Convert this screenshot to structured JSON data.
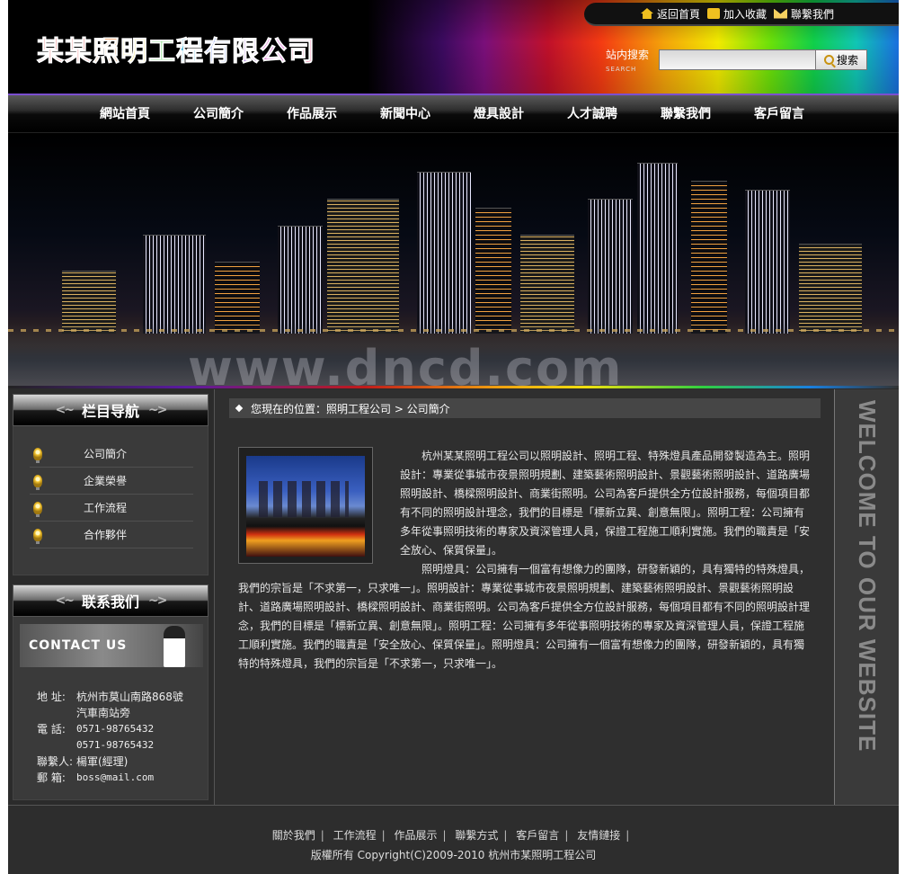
{
  "header": {
    "logo_chars": [
      {
        "ch": "某",
        "color": "#e01818"
      },
      {
        "ch": "某",
        "color": "#e01818"
      },
      {
        "ch": "照",
        "color": "#f07010"
      },
      {
        "ch": "明",
        "color": "#f0d010"
      },
      {
        "ch": "工",
        "color": "#20c020"
      },
      {
        "ch": "程",
        "color": "#10a0d0"
      },
      {
        "ch": "有",
        "color": "#2050e0"
      },
      {
        "ch": "限",
        "color": "#8030d0"
      },
      {
        "ch": "公",
        "color": "#d020c0"
      },
      {
        "ch": "司",
        "color": "#e01860"
      }
    ],
    "top_links": {
      "home": "返回首頁",
      "favorite": "加入收藏",
      "contact": "聯繫我們"
    },
    "search": {
      "label": "站内搜索",
      "label_en": "SEARCH",
      "value": "",
      "button": "搜索"
    }
  },
  "nav": {
    "items": [
      "網站首頁",
      "公司簡介",
      "作品展示",
      "新聞中心",
      "燈具設計",
      "人才誠聘",
      "聯繫我們",
      "客戶留言"
    ]
  },
  "banner": {
    "watermark": "www.dncd.com"
  },
  "sidebar": {
    "category_title": "栏目导航",
    "categories": [
      "公司簡介",
      "企業榮譽",
      "工作流程",
      "合作夥伴"
    ],
    "contact_title": "联系我们",
    "contact_banner": "CONTACT US",
    "contact": {
      "address_label": "地 址:",
      "address_1": "杭州市莫山南路868號",
      "address_2": "汽車南站旁",
      "phone_label": "電 話:",
      "phone_1": "0571-98765432",
      "phone_2": "0571-98765432",
      "person_label": "聯繫人:",
      "person": "楊軍(經理)",
      "email_label": "郵 箱:",
      "email": "boss@mail.com"
    }
  },
  "main": {
    "breadcrumb": "您現在的位置：照明工程公司 > 公司簡介",
    "paragraph_1": "杭州某某照明工程公司以照明設計、照明工程、特殊燈具產品開發製造為主。照明設計：專業從事城市夜景照明規劃、建築藝術照明設計、景觀藝術照明設計、道路廣場照明設計、橋樑照明設計、商業街照明。公司為客戶提供全方位設計服務，每個項目都有不同的照明設計理念，我們的目標是「標新立異、創意無限」。照明工程：公司擁有多年從事照明技術的專家及資深管理人員，保證工程施工順利實施。我們的職責是「安全放心、保質保量」。",
    "paragraph_2": "照明燈具：公司擁有一個富有想像力的團隊，研發新穎的，具有獨特的特殊燈具，我們的宗旨是「不求第一，只求唯一」。照明設計：專業從事城市夜景照明規劃、建築藝術照明設計、景觀藝術照明設計、道路廣場照明設計、橋樑照明設計、商業街照明。公司為客戶提供全方位設計服務，每個項目都有不同的照明設計理念，我們的目標是「標新立異、創意無限」。照明工程：公司擁有多年從事照明技術的專家及資深管理人員，保證工程施工順利實施。我們的職責是「安全放心、保質保量」。照明燈具：公司擁有一個富有想像力的團隊，研發新穎的，具有獨特的特殊燈具，我們的宗旨是「不求第一，只求唯一」。"
  },
  "welcome": "WELCOME TO OUR WEBSITE",
  "footer": {
    "links": [
      "關於我們",
      "工作流程",
      "作品展示",
      "聯繫方式",
      "客戶留言",
      "友情鏈接"
    ],
    "copyright": "版權所有 Copyright(C)2009-2010 杭州市某照明工程公司"
  }
}
